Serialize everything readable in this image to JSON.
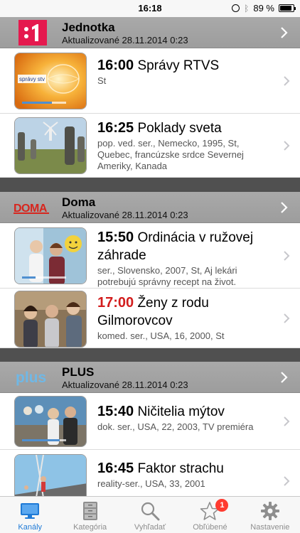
{
  "status_bar": {
    "time": "16:18",
    "battery": "89 %",
    "battery_level": 0.89
  },
  "channels": [
    {
      "name": "Jednotka",
      "updated": "Aktualizované 28.11.2014 0:23",
      "logo_text": ":1",
      "logo_color": "#e5194e",
      "programs": [
        {
          "time": "16:00",
          "title": "Správy RTVS",
          "desc": "St",
          "live": false,
          "progress": 0.68,
          "thumb_caption": "správy stv"
        },
        {
          "time": "16:25",
          "title": "Poklady sveta",
          "desc": "pop. ved. ser., Nemecko, 1995, St, Quebec, francúzske srdce Severnej Ameriky, Kanada",
          "live": false
        }
      ]
    },
    {
      "name": "Doma",
      "updated": "Aktualizované 28.11.2014 0:23",
      "logo_text": "DOMA",
      "logo_color": "#d7261e",
      "programs": [
        {
          "time": "15:50",
          "title": "Ordinácia v ružovej záhrade",
          "desc": "ser., Slovensko, 2007, St, Aj lekári potrebujú správny recept na život.",
          "live": false,
          "progress": 0.3
        },
        {
          "time": "17:00",
          "title": "Ženy z rodu Gilmorovcov",
          "desc": "komed. ser., USA, 16, 2000, St",
          "live": true
        }
      ]
    },
    {
      "name": "PLUS",
      "updated": "Aktualizované 28.11.2014 0:23",
      "logo_text": "plus",
      "logo_color": "#6fb8e6",
      "programs": [
        {
          "time": "15:40",
          "title": "Ničitelia mýtov",
          "desc": "dok. ser., USA, 22, 2003, TV premiéra",
          "live": false,
          "progress": 0.85
        },
        {
          "time": "16:45",
          "title": "Faktor strachu",
          "desc": "reality-ser., USA, 33, 2001",
          "live": false
        }
      ]
    }
  ],
  "tabs": [
    {
      "label": "Kanály",
      "icon": "monitor-icon",
      "active": true
    },
    {
      "label": "Kategória",
      "icon": "cabinet-icon",
      "active": false
    },
    {
      "label": "Vyhľadať",
      "icon": "search-icon",
      "active": false
    },
    {
      "label": "Obľúbené",
      "icon": "star-icon",
      "active": false,
      "badge": "1"
    },
    {
      "label": "Nastavenie",
      "icon": "gear-icon",
      "active": false
    }
  ],
  "colors": {
    "accent": "#1f7ad6",
    "live_time": "#d21d1d",
    "header_gray": "#a5a5a5",
    "badge": "#ff3b30"
  }
}
